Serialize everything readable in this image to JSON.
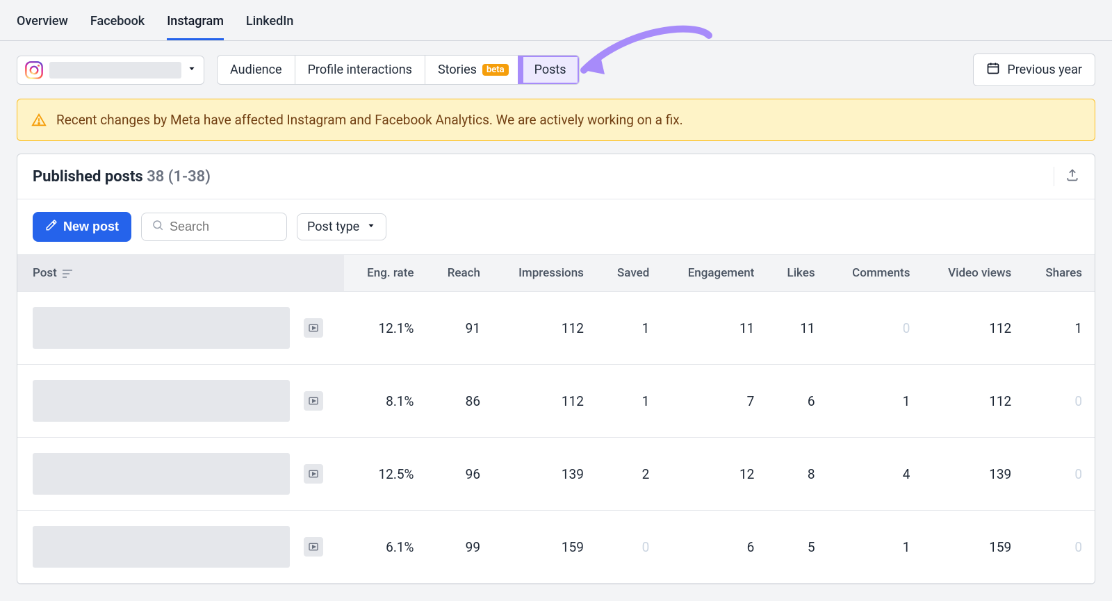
{
  "nav": {
    "tabs": [
      {
        "label": "Overview",
        "active": false
      },
      {
        "label": "Facebook",
        "active": false
      },
      {
        "label": "Instagram",
        "active": true
      },
      {
        "label": "LinkedIn",
        "active": false
      }
    ]
  },
  "subnav": {
    "items": [
      {
        "label": "Audience",
        "badge": null,
        "highlight": false
      },
      {
        "label": "Profile interactions",
        "badge": null,
        "highlight": false
      },
      {
        "label": "Stories",
        "badge": "beta",
        "highlight": false
      },
      {
        "label": "Posts",
        "badge": null,
        "highlight": true
      }
    ]
  },
  "date_button": {
    "label": "Previous year"
  },
  "alert": {
    "text": "Recent changes by Meta have affected Instagram and Facebook Analytics. We are actively working on a fix."
  },
  "card": {
    "title_label": "Published posts ",
    "title_count": "38 (1-38)",
    "new_post_label": "New post",
    "search_placeholder": "Search",
    "post_type_label": "Post type"
  },
  "table": {
    "columns": [
      "Post",
      "Eng. rate",
      "Reach",
      "Impressions",
      "Saved",
      "Engagement",
      "Likes",
      "Comments",
      "Video views",
      "Shares"
    ],
    "rows": [
      {
        "eng_rate": "12.1%",
        "reach": "91",
        "impressions": "112",
        "saved": "1",
        "engagement": "11",
        "likes": "11",
        "comments": "0",
        "video_views": "112",
        "shares": "1"
      },
      {
        "eng_rate": "8.1%",
        "reach": "86",
        "impressions": "112",
        "saved": "1",
        "engagement": "7",
        "likes": "6",
        "comments": "1",
        "video_views": "112",
        "shares": "0"
      },
      {
        "eng_rate": "12.5%",
        "reach": "96",
        "impressions": "139",
        "saved": "2",
        "engagement": "12",
        "likes": "8",
        "comments": "4",
        "video_views": "139",
        "shares": "0"
      },
      {
        "eng_rate": "6.1%",
        "reach": "99",
        "impressions": "159",
        "saved": "0",
        "engagement": "6",
        "likes": "5",
        "comments": "1",
        "video_views": "159",
        "shares": "0"
      }
    ]
  },
  "annotation": {
    "arrow_color": "#a78bfa"
  }
}
